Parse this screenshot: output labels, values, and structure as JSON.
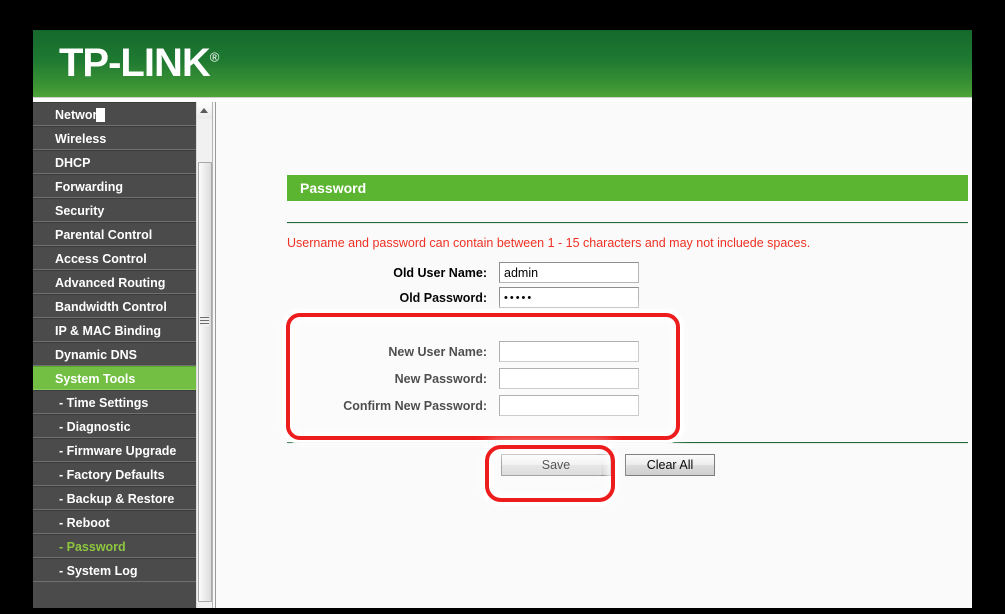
{
  "brand": {
    "logo_text": "TP-LINK",
    "logo_mark": "®"
  },
  "sidebar": {
    "items": [
      {
        "label": "Network",
        "type": "top",
        "state": "normal"
      },
      {
        "label": "Wireless",
        "type": "top",
        "state": "normal"
      },
      {
        "label": "DHCP",
        "type": "top",
        "state": "normal"
      },
      {
        "label": "Forwarding",
        "type": "top",
        "state": "normal"
      },
      {
        "label": "Security",
        "type": "top",
        "state": "normal"
      },
      {
        "label": "Parental Control",
        "type": "top",
        "state": "normal"
      },
      {
        "label": "Access Control",
        "type": "top",
        "state": "normal"
      },
      {
        "label": "Advanced Routing",
        "type": "top",
        "state": "normal"
      },
      {
        "label": "Bandwidth Control",
        "type": "top",
        "state": "normal"
      },
      {
        "label": "IP & MAC Binding",
        "type": "top",
        "state": "normal"
      },
      {
        "label": "Dynamic DNS",
        "type": "top",
        "state": "normal"
      },
      {
        "label": "System Tools",
        "type": "top",
        "state": "active-parent"
      },
      {
        "label": "- Time Settings",
        "type": "sub",
        "state": "normal"
      },
      {
        "label": "- Diagnostic",
        "type": "sub",
        "state": "normal"
      },
      {
        "label": "- Firmware Upgrade",
        "type": "sub",
        "state": "normal"
      },
      {
        "label": "- Factory Defaults",
        "type": "sub",
        "state": "normal"
      },
      {
        "label": "- Backup & Restore",
        "type": "sub",
        "state": "normal"
      },
      {
        "label": "- Reboot",
        "type": "sub",
        "state": "normal"
      },
      {
        "label": "- Password",
        "type": "sub",
        "state": "active-sub"
      },
      {
        "label": "- System Log",
        "type": "sub",
        "state": "normal"
      }
    ]
  },
  "content": {
    "page_title": "Password",
    "warning": "Username and password can contain between 1 - 15 characters and may not incluede spaces.",
    "fields": {
      "old_user_name": {
        "label": "Old User Name:",
        "value": "admin"
      },
      "old_password": {
        "label": "Old Password:",
        "value": "•••••"
      },
      "new_user_name": {
        "label": "New User Name:",
        "value": ""
      },
      "new_password": {
        "label": "New Password:",
        "value": ""
      },
      "confirm_password": {
        "label": "Confirm New Password:",
        "value": ""
      }
    },
    "buttons": {
      "save": "Save",
      "clear_all": "Clear All"
    }
  },
  "colors": {
    "header_dark_green": "#15682c",
    "header_light_green": "#4da536",
    "title_bar_green": "#5cb531",
    "active_menu_green": "#72bf44",
    "active_sub_green": "#8dc63f",
    "warning_red": "#ef3124",
    "annotation_red": "#ee1d1d",
    "sidebar_gray": "#4b4b4b"
  }
}
